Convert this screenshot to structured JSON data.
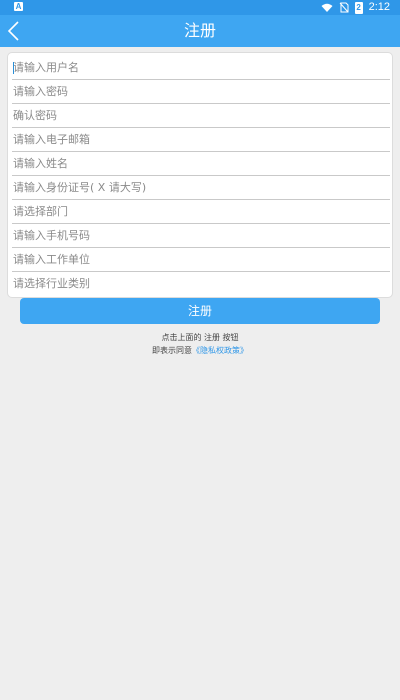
{
  "status_bar": {
    "badge": "A",
    "time": "2:12",
    "battery_level": "2"
  },
  "app_bar": {
    "title": "注册"
  },
  "form": {
    "fields": [
      {
        "placeholder": "请输入用户名"
      },
      {
        "placeholder": "请输入密码"
      },
      {
        "placeholder": "确认密码"
      },
      {
        "placeholder": "请输入电子邮箱"
      },
      {
        "placeholder": "请输入姓名"
      },
      {
        "placeholder": "请输入身份证号( X 请大写)"
      },
      {
        "placeholder": "请选择部门"
      },
      {
        "placeholder": "请输入手机号码"
      },
      {
        "placeholder": "请输入工作单位"
      },
      {
        "placeholder": "请选择行业类别"
      }
    ]
  },
  "submit": {
    "label": "注册"
  },
  "notice": {
    "line1": "点击上面的 注册 按钮",
    "line2_prefix": "即表示同意",
    "privacy_link": "《隐私权政策》"
  },
  "colors": {
    "status_bar": "#2f97e8",
    "app_bar": "#3ea6f2",
    "accent": "#3ea6f2",
    "background": "#eeeeee"
  }
}
